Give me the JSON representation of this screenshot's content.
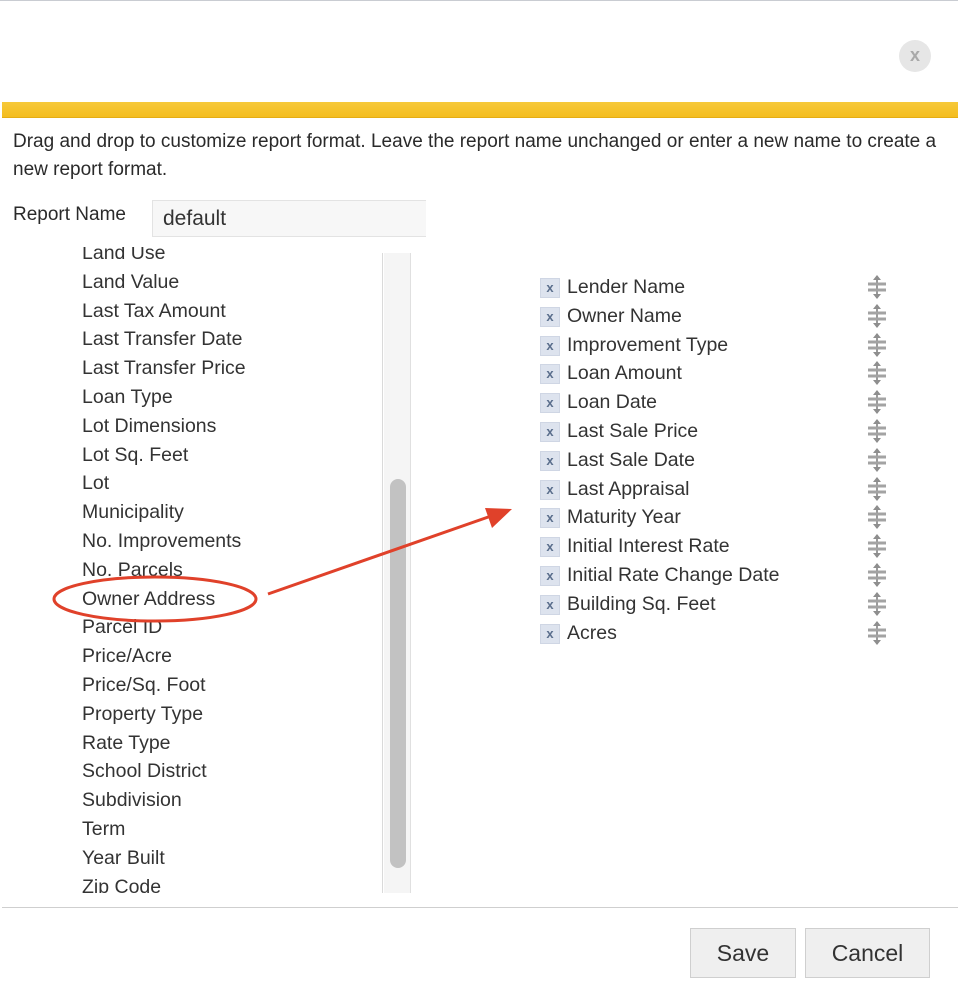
{
  "dialog": {
    "close_label": "x",
    "instructions": "Drag and drop to customize report format. Leave the report name unchanged or enter a new name to create a new report format.",
    "report_name_label": "Report Name",
    "report_name_value": "default"
  },
  "available_fields": [
    "Land Use",
    "Land Value",
    "Last Tax Amount",
    "Last Transfer Date",
    "Last Transfer Price",
    "Loan Type",
    "Lot Dimensions",
    "Lot Sq. Feet",
    "Lot",
    "Municipality",
    "No. Improvements",
    "No. Parcels",
    "Owner Address",
    "Parcel ID",
    "Price/Acre",
    "Price/Sq. Foot",
    "Property Type",
    "Rate Type",
    "School District",
    "Subdivision",
    "Term",
    "Year Built",
    "Zip Code"
  ],
  "selected_fields": [
    "Lender Name",
    "Owner Name",
    "Improvement Type",
    "Loan Amount",
    "Loan Date",
    "Last Sale Price",
    "Last Sale Date",
    "Last Appraisal",
    "Maturity Year",
    "Initial Interest Rate",
    "Initial Rate Change Date",
    "Building Sq. Feet",
    "Acres"
  ],
  "remove_glyph": "x",
  "buttons": {
    "save": "Save",
    "cancel": "Cancel"
  },
  "colors": {
    "accent_bar": "#f4bd1f",
    "annotation": "#e0412a",
    "remove_icon_bg": "#dde3ee"
  },
  "icons": {
    "close": "close-icon",
    "remove": "remove-x-icon",
    "drag_handle": "drag-handle-icon"
  }
}
